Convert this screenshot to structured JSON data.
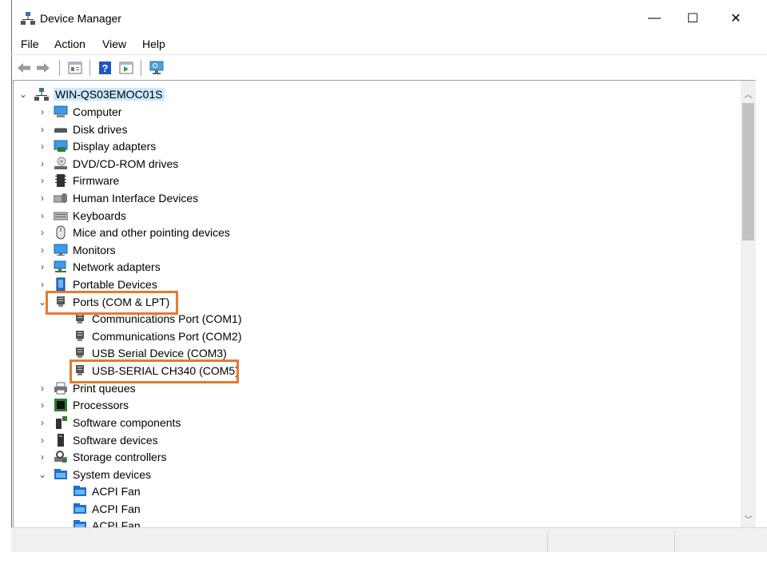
{
  "window": {
    "title": "Device Manager",
    "controls": {
      "minimize": "—",
      "maximize": "☐",
      "close": "✕"
    }
  },
  "menu": {
    "items": [
      "File",
      "Action",
      "View",
      "Help"
    ]
  },
  "toolbar": {
    "buttons": [
      "back-icon",
      "forward-icon",
      "properties-icon",
      "help-icon",
      "update-driver-icon",
      "scan-hardware-icon"
    ]
  },
  "tree": {
    "root": {
      "label": "WIN-QS03EMOC01S",
      "expanded": true
    },
    "categories": [
      {
        "label": "Computer",
        "icon": "computer-icon",
        "expanded": false
      },
      {
        "label": "Disk drives",
        "icon": "disk-drive-icon",
        "expanded": false
      },
      {
        "label": "Display adapters",
        "icon": "display-adapter-icon",
        "expanded": false
      },
      {
        "label": "DVD/CD-ROM drives",
        "icon": "dvd-drive-icon",
        "expanded": false
      },
      {
        "label": "Firmware",
        "icon": "firmware-icon",
        "expanded": false
      },
      {
        "label": "Human Interface Devices",
        "icon": "hid-icon",
        "expanded": false
      },
      {
        "label": "Keyboards",
        "icon": "keyboard-icon",
        "expanded": false
      },
      {
        "label": "Mice and other pointing devices",
        "icon": "mouse-icon",
        "expanded": false
      },
      {
        "label": "Monitors",
        "icon": "monitor-icon",
        "expanded": false
      },
      {
        "label": "Network adapters",
        "icon": "network-adapter-icon",
        "expanded": false
      },
      {
        "label": "Portable Devices",
        "icon": "portable-device-icon",
        "expanded": false
      },
      {
        "label": "Ports (COM & LPT)",
        "icon": "port-icon",
        "expanded": true,
        "children": [
          {
            "label": "Communications Port (COM1)",
            "icon": "port-icon"
          },
          {
            "label": "Communications Port (COM2)",
            "icon": "port-icon"
          },
          {
            "label": "USB Serial Device (COM3)",
            "icon": "port-icon"
          },
          {
            "label": "USB-SERIAL CH340 (COM5)",
            "icon": "port-icon"
          }
        ]
      },
      {
        "label": "Print queues",
        "icon": "printer-icon",
        "expanded": false
      },
      {
        "label": "Processors",
        "icon": "processor-icon",
        "expanded": false
      },
      {
        "label": "Software components",
        "icon": "software-component-icon",
        "expanded": false
      },
      {
        "label": "Software devices",
        "icon": "software-device-icon",
        "expanded": false
      },
      {
        "label": "Storage controllers",
        "icon": "storage-controller-icon",
        "expanded": false
      },
      {
        "label": "System devices",
        "icon": "system-devices-icon",
        "expanded": true,
        "children": [
          {
            "label": "ACPI Fan",
            "icon": "system-devices-icon"
          },
          {
            "label": "ACPI Fan",
            "icon": "system-devices-icon"
          },
          {
            "label": "ACPI Fan",
            "icon": "system-devices-icon"
          }
        ]
      }
    ]
  },
  "highlight_color": "#e87a2b",
  "selection_color": "#cce8ff"
}
